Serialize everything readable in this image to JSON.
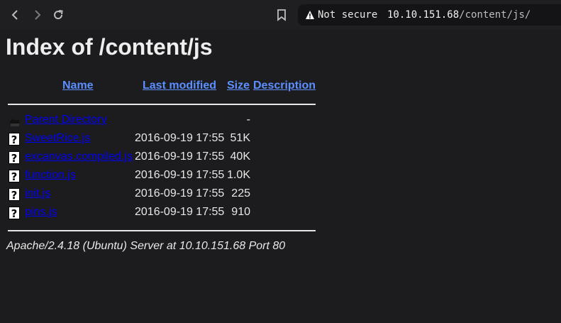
{
  "browser": {
    "security_label": "Not secure",
    "url_host": "10.10.151.68",
    "url_path": "/content/js/"
  },
  "page": {
    "title": "Index of /content/js",
    "headers": {
      "name": "Name",
      "last_modified": "Last modified",
      "size": "Size",
      "description": "Description"
    },
    "rows": [
      {
        "icon": "back-icon",
        "name": "Parent Directory",
        "modified": "",
        "size": "-"
      },
      {
        "icon": "unknown-file-icon",
        "name": "SweetRice.js",
        "modified": "2016-09-19 17:55",
        "size": "51K"
      },
      {
        "icon": "unknown-file-icon",
        "name": "excanvas.compiled.js",
        "modified": "2016-09-19 17:55",
        "size": "40K"
      },
      {
        "icon": "unknown-file-icon",
        "name": "function.js",
        "modified": "2016-09-19 17:55",
        "size": "1.0K"
      },
      {
        "icon": "unknown-file-icon",
        "name": "init.js",
        "modified": "2016-09-19 17:55",
        "size": "225"
      },
      {
        "icon": "unknown-file-icon",
        "name": "pins.js",
        "modified": "2016-09-19 17:55",
        "size": "910"
      }
    ],
    "footer": "Apache/2.4.18 (Ubuntu) Server at 10.10.151.68 Port 80"
  },
  "colors": {
    "background": "#1c1c1e",
    "link": "#5c8fff",
    "text": "#e8e8e8"
  }
}
